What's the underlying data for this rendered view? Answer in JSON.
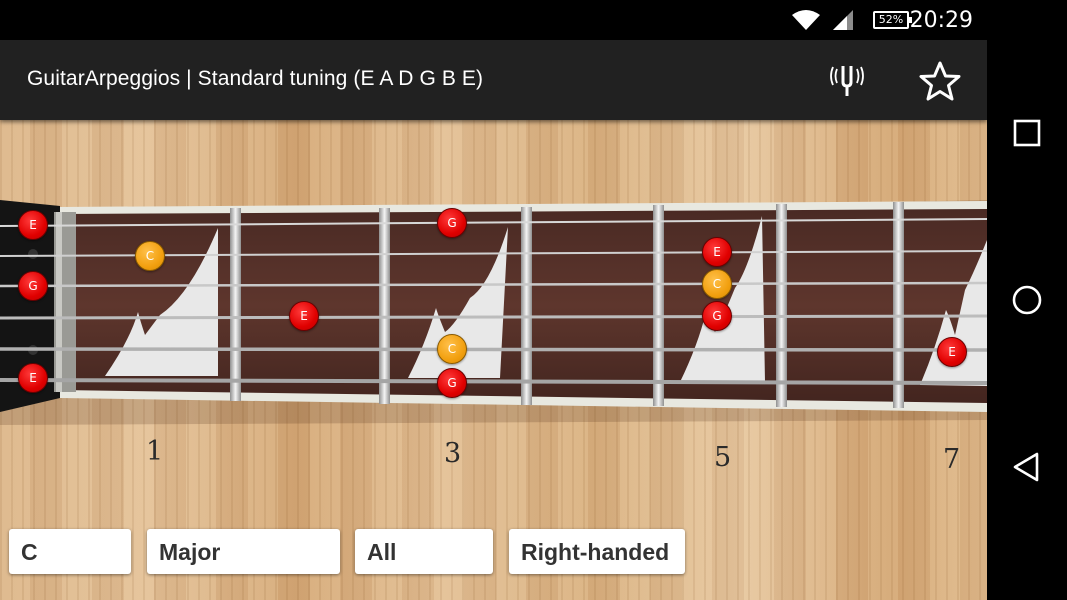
{
  "status_bar": {
    "time": "20:29",
    "battery": "52%",
    "wifi_icon": "wifi-icon",
    "signal_icon": "cell-signal-icon"
  },
  "app_bar": {
    "title": "GuitarArpeggios | Standard tuning (E A D G B E)",
    "tuner_icon": "tuning-fork-icon",
    "favorite_icon": "star-outline-icon"
  },
  "fretboard": {
    "fret_numbers": [
      "1",
      "3",
      "5",
      "7"
    ],
    "notes": {
      "n1": "E",
      "n2": "G",
      "n3": "E",
      "n4": "C",
      "n5": "E",
      "n6": "G",
      "n7": "C",
      "n8": "G",
      "n9": "E",
      "n10": "C",
      "n11": "G",
      "n12": "E"
    },
    "colors": {
      "note_red": "#e00000",
      "note_root_orange": "#f2a010"
    }
  },
  "controls": {
    "root": "C",
    "chord_type": "Major",
    "position": "All",
    "handedness": "Right-handed"
  },
  "nav_bar": {
    "recents_icon": "square-recents-icon",
    "home_icon": "circle-home-icon",
    "back_icon": "triangle-back-icon"
  }
}
